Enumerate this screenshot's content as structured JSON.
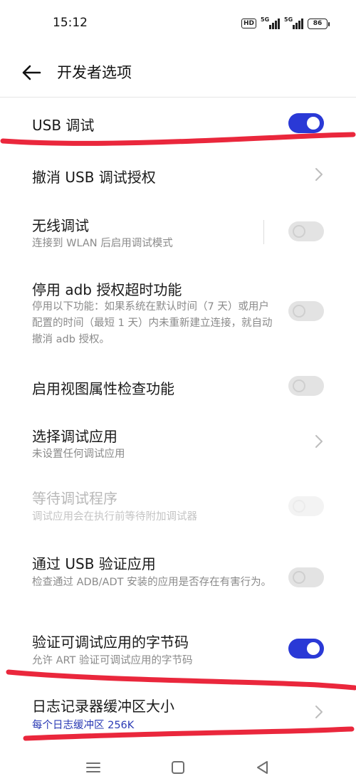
{
  "status_bar": {
    "time": "15:12",
    "hd_label": "HD",
    "sim1_label": "5G",
    "sim2_label": "5G",
    "battery": "86"
  },
  "header": {
    "back_icon": "arrow-left-icon",
    "title": "开发者选项"
  },
  "settings": [
    {
      "title": "USB 调试",
      "control": "toggle",
      "state": "on"
    },
    {
      "title": "撤消 USB 调试授权",
      "control": "chevron"
    },
    {
      "title": "无线调试",
      "subtitle": "连接到 WLAN 后启用调试模式",
      "control": "toggle",
      "state": "off"
    },
    {
      "title": "停用 adb 授权超时功能",
      "subtitle": "停用以下功能：如果系统在默认时间（7 天）或用户配置的时间（最短 1 天）内未重新建立连接，就自动撤消 adb 授权。",
      "control": "toggle",
      "state": "off"
    },
    {
      "title": "启用视图属性检查功能",
      "control": "toggle",
      "state": "off"
    },
    {
      "title": "选择调试应用",
      "subtitle": "未设置任何调试应用",
      "control": "chevron"
    },
    {
      "title": "等待调试程序",
      "subtitle": "调试应用会在执行前等待附加调试器",
      "control": "toggle",
      "state": "off",
      "disabled": true
    },
    {
      "title": "通过 USB 验证应用",
      "subtitle": "检查通过 ADB/ADT 安装的应用是否存在有害行为。",
      "control": "toggle",
      "state": "off"
    },
    {
      "title": "验证可调试应用的字节码",
      "subtitle": "允许 ART 验证可调试应用的字节码",
      "control": "toggle",
      "state": "on"
    },
    {
      "title": "日志记录器缓冲区大小",
      "subtitle": "每个日志缓冲区 256K",
      "control": "chevron"
    }
  ],
  "nav_bar": {
    "menu_icon": "menu-icon",
    "home_icon": "home-square-icon",
    "back_icon": "back-triangle-icon"
  },
  "colors": {
    "accent": "#2a39d6",
    "annotation": "#e8152b",
    "subtitle_link": "#2b3bb5"
  }
}
